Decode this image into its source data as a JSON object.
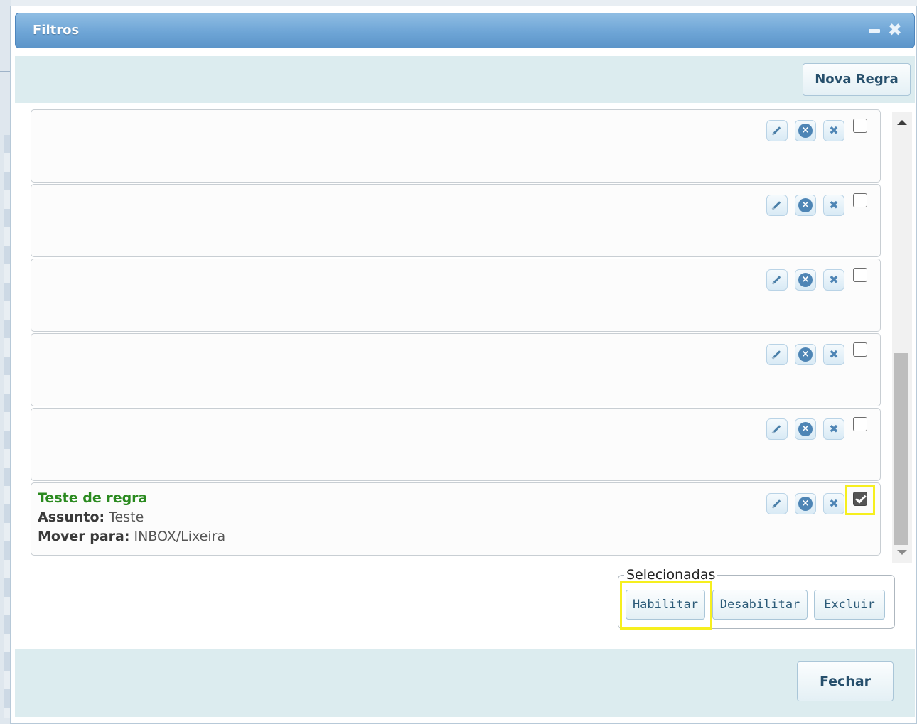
{
  "dialog": {
    "title": "Filtros",
    "minimize_symbol": "minimize-icon",
    "close_symbol": "close-icon"
  },
  "toolbar": {
    "new_rule_label": "Nova Regra"
  },
  "rules": [
    {
      "name": "",
      "checked": false
    },
    {
      "name": "",
      "checked": false
    },
    {
      "name": "",
      "checked": false
    },
    {
      "name": "",
      "checked": false
    },
    {
      "name": "",
      "checked": false
    },
    {
      "name": "Teste de regra",
      "subject_label": "Assunto:",
      "subject_value": "Teste",
      "move_label": "Mover para:",
      "move_value": "INBOX/Lixeira",
      "checked": true
    }
  ],
  "selected_group": {
    "legend": "Selecionadas",
    "enable_label": "Habilitar",
    "disable_label": "Desabilitar",
    "delete_label": "Excluir"
  },
  "footer": {
    "close_label": "Fechar"
  },
  "colors": {
    "title_bar": "#6ea5d6",
    "rule_name": "#2a8a1f",
    "highlight": "#f6ef1e"
  }
}
